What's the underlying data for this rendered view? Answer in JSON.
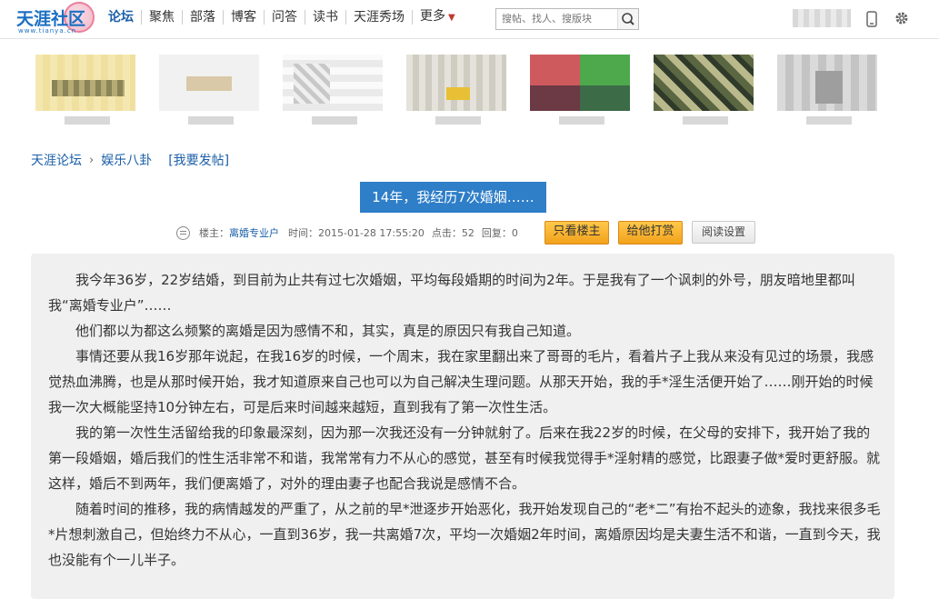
{
  "header": {
    "logo_text": "天涯社区",
    "logo_url": "www.tianya.cn",
    "nav": [
      "论坛",
      "聚焦",
      "部落",
      "博客",
      "问答",
      "读书",
      "天涯秀场",
      "更多"
    ],
    "search_placeholder": "搜帖、找人、搜版块",
    "icons": [
      "search-icon",
      "phone-icon",
      "gear-icon"
    ]
  },
  "breadcrumb": {
    "root": "天涯论坛",
    "board": "娱乐八卦",
    "post_link": "[我要发帖]"
  },
  "post": {
    "title": "14年，我经历7次婚姻……",
    "author_label": "楼主：",
    "author": "离婚专业户",
    "time_label": "时间：",
    "time": "2015-01-28 17:55:20",
    "clicks_label": "点击：",
    "clicks": "52",
    "replies_label": "回复：",
    "replies": "0",
    "buttons": {
      "only_host": "只看楼主",
      "tip": "给他打赏",
      "read_settings": "阅读设置"
    },
    "paragraphs": [
      "我今年36岁，22岁结婚，到目前为止共有过七次婚姻，平均每段婚期的时间为2年。于是我有了一个讽刺的外号，朋友暗地里都叫我“离婚专业户”……",
      "他们都以为都这么频繁的离婚是因为感情不和，其实，真是的原因只有我自己知道。",
      "事情还要从我16岁那年说起，在我16岁的时候，一个周末，我在家里翻出来了哥哥的毛片，看着片子上我从来没有见过的场景，我感觉热血沸腾，也是从那时候开始，我才知道原来自己也可以为自己解决生理问题。从那天开始，我的手*淫生活便开始了……刚开始的时候我一次大概能坚持10分钟左右，可是后来时间越来越短，直到我有了第一次性生活。",
      "我的第一次性生活留给我的印象最深刻，因为那一次我还没有一分钟就射了。后来在我22岁的时候，在父母的安排下，我开始了我的第一段婚姻，婚后我们的性生活非常不和谐，我常常有力不从心的感觉，甚至有时候我觉得手*淫射精的感觉，比跟妻子做*爱时更舒服。就这样，婚后不到两年，我们便离婚了，对外的理由妻子也配合我说是感情不合。",
      "随着时间的推移，我的病情越发的严重了，从之前的早*泄逐步开始恶化，我开始发现自己的“老*二”有抬不起头的迹象，我找来很多毛*片想刺激自己，但始终力不从心，一直到36岁，我一共离婚7次，平均一次婚姻2年时间，离婚原因均是夫妻生活不和谐，一直到今天，我也没能有个一儿半子。"
    ]
  }
}
